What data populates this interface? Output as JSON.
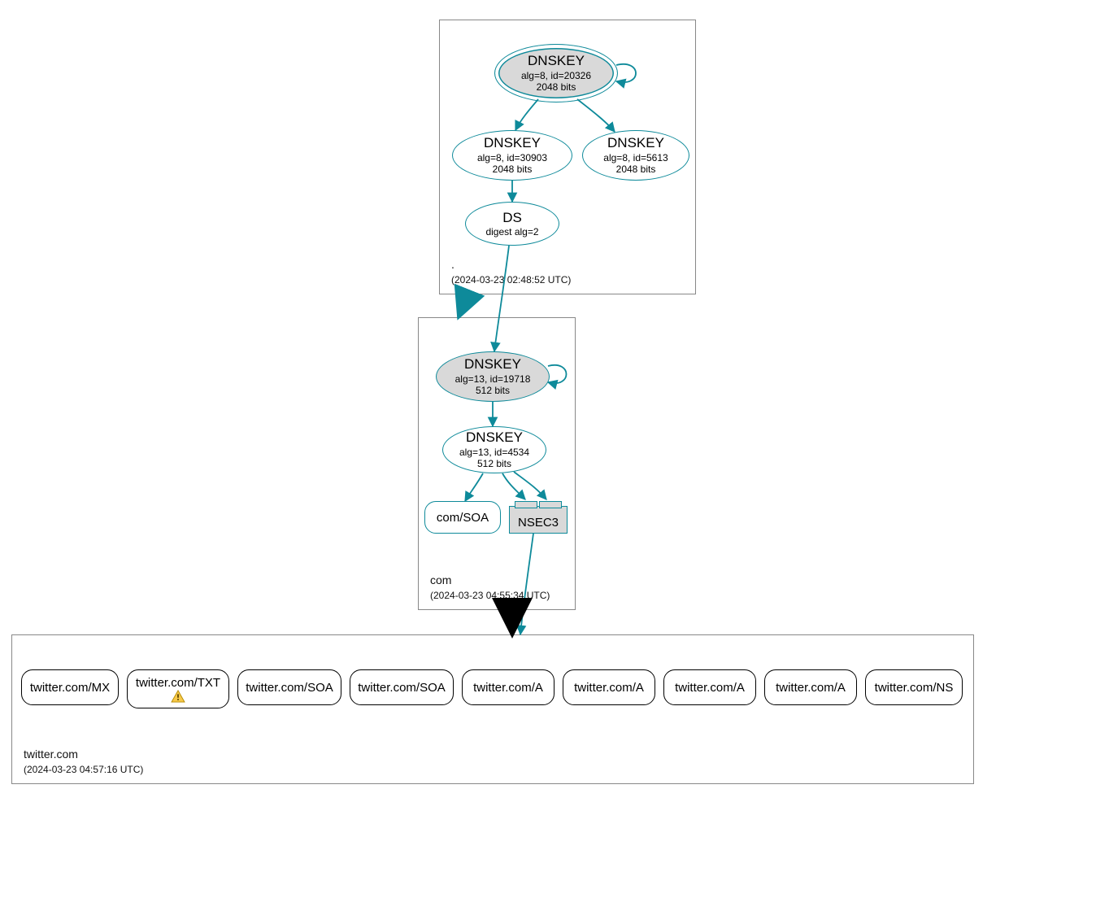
{
  "colors": {
    "teal": "#0e8a9a",
    "black": "#000000",
    "grey_fill": "#d9d9d9"
  },
  "zones": {
    "root": {
      "name": ".",
      "timestamp": "(2024-03-23 02:48:52 UTC)"
    },
    "com": {
      "name": "com",
      "timestamp": "(2024-03-23 04:55:34 UTC)"
    },
    "leaf": {
      "name": "twitter.com",
      "timestamp": "(2024-03-23 04:57:16 UTC)"
    }
  },
  "root_nodes": {
    "ksk": {
      "title": "DNSKEY",
      "line2": "alg=8, id=20326",
      "line3": "2048 bits"
    },
    "zsk1": {
      "title": "DNSKEY",
      "line2": "alg=8, id=30903",
      "line3": "2048 bits"
    },
    "zsk2": {
      "title": "DNSKEY",
      "line2": "alg=8, id=5613",
      "line3": "2048 bits"
    },
    "ds": {
      "title": "DS",
      "line2": "digest alg=2"
    }
  },
  "com_nodes": {
    "ksk": {
      "title": "DNSKEY",
      "line2": "alg=13, id=19718",
      "line3": "512 bits"
    },
    "zsk": {
      "title": "DNSKEY",
      "line2": "alg=13, id=4534",
      "line3": "512 bits"
    },
    "soa": {
      "label": "com/SOA"
    },
    "nsec3": {
      "label": "NSEC3"
    }
  },
  "leaf_records": [
    {
      "label": "twitter.com/MX",
      "warn": false
    },
    {
      "label": "twitter.com/TXT",
      "warn": true
    },
    {
      "label": "twitter.com/SOA",
      "warn": false
    },
    {
      "label": "twitter.com/SOA",
      "warn": false
    },
    {
      "label": "twitter.com/A",
      "warn": false
    },
    {
      "label": "twitter.com/A",
      "warn": false
    },
    {
      "label": "twitter.com/A",
      "warn": false
    },
    {
      "label": "twitter.com/A",
      "warn": false
    },
    {
      "label": "twitter.com/NS",
      "warn": false
    }
  ]
}
